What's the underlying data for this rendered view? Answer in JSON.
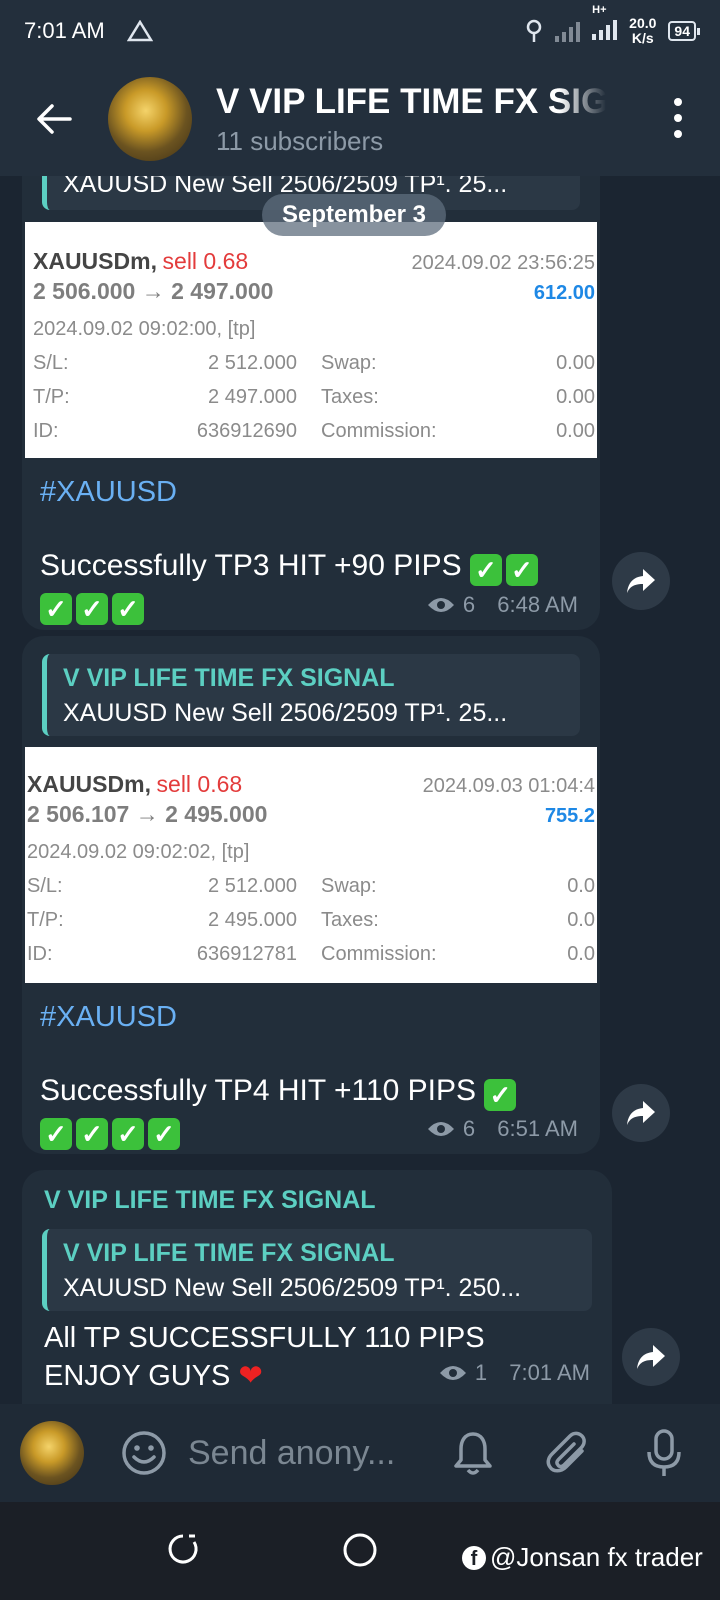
{
  "status_bar": {
    "time": "7:01 AM",
    "net_type": "H+",
    "speed_value": "20.0",
    "speed_unit": "K/s",
    "battery": "94"
  },
  "header": {
    "channel_name": "V VIP LIFE TIME FX SIGNAL",
    "subscribers": "11 subscribers"
  },
  "date_divider": "September 3",
  "messages": [
    {
      "reply_text": "XAUUSD New Sell 2506/2509  TP¹. 25...",
      "trade": {
        "symbol": "XAUUSDm,",
        "side": "sell 0.68",
        "close_time": "2024.09.02 23:56:25",
        "prices": "2 506.000 → 2 497.000",
        "profit": "612.00",
        "open_time": "2024.09.02 09:02:00, [tp]",
        "sl_label": "S/L:",
        "sl_value": "2 512.000",
        "tp_label": "T/P:",
        "tp_value": "2 497.000",
        "id_label": "ID:",
        "id_value": "636912690",
        "swap_label": "Swap:",
        "swap_value": "0.00",
        "taxes_label": "Taxes:",
        "taxes_value": "0.00",
        "commission_label": "Commission:",
        "commission_value": "0.00"
      },
      "hashtag": "#XAUUSD",
      "text": "Successfully TP3 HIT +90 PIPS",
      "checks": 5,
      "views": "6",
      "time": "6:48 AM"
    },
    {
      "reply_name": "V VIP LIFE TIME FX SIGNAL",
      "reply_text": "XAUUSD New Sell 2506/2509  TP¹. 25...",
      "trade": {
        "symbol": "XAUUSDm,",
        "side": "sell 0.68",
        "close_time": "2024.09.03 01:04:4",
        "prices": "2 506.107 → 2 495.000",
        "profit": "755.2",
        "open_time": "2024.09.02 09:02:02, [tp]",
        "sl_label": "S/L:",
        "sl_value": "2 512.000",
        "tp_label": "T/P:",
        "tp_value": "2 495.000",
        "id_label": "ID:",
        "id_value": "636912781",
        "swap_label": "Swap:",
        "swap_value": "0.0",
        "taxes_label": "Taxes:",
        "taxes_value": "0.0",
        "commission_label": "Commission:",
        "commission_value": "0.0"
      },
      "hashtag": "#XAUUSD",
      "text": "Successfully TP4 HIT +110 PIPS",
      "checks": 5,
      "views": "6",
      "time": "6:51 AM"
    },
    {
      "sender": "V VIP LIFE TIME FX SIGNAL",
      "reply_name": "V VIP LIFE TIME FX SIGNAL",
      "reply_text": "XAUUSD New Sell 2506/2509  TP¹. 250...",
      "text_line1": "All TP SUCCESSFULLY 110 PIPS",
      "text_line2": "ENJOY GUYS",
      "views": "1",
      "time": "7:01 AM"
    }
  ],
  "input": {
    "placeholder": "Send anony..."
  },
  "watermark": "@Jonsan fx trader",
  "colors": {
    "accent_teal": "#5ccfc2",
    "hashtag_blue": "#6ab0f3",
    "bubble_bg": "#222e3a",
    "profit_blue": "#1e88e5",
    "sell_red": "#e33b3b",
    "check_green": "#3cc13b"
  },
  "icons": [
    "back-arrow-icon",
    "more-vert-icon",
    "eye-icon",
    "share-icon",
    "emoji-icon",
    "bell-icon",
    "attach-icon",
    "mic-icon",
    "recents-icon",
    "home-icon"
  ]
}
